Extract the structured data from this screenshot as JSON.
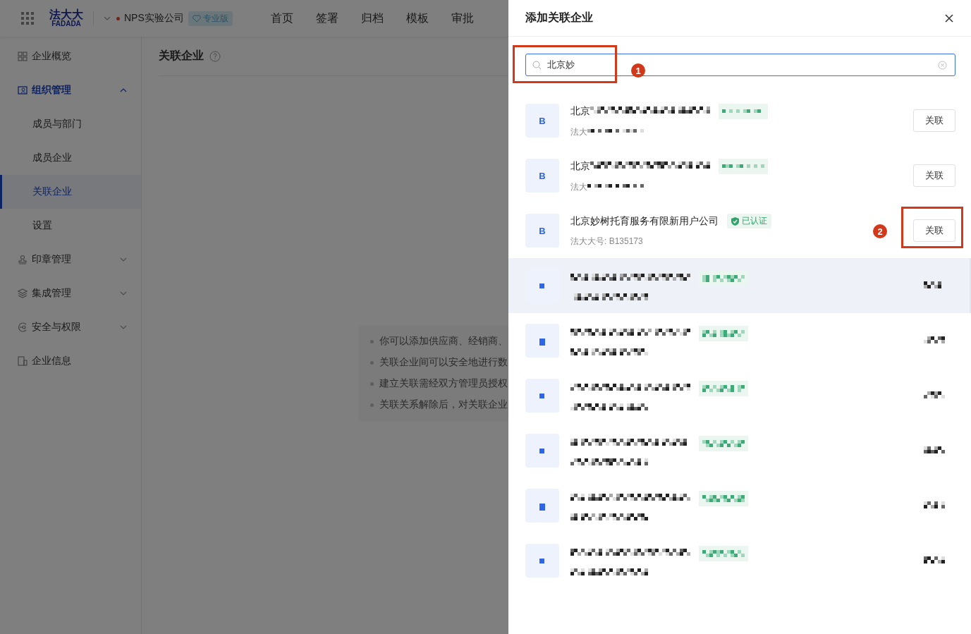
{
  "topbar": {
    "logo_cn": "法大大",
    "logo_en": "FADADA",
    "company": "NPS实验公司",
    "edition": "专业版",
    "nav": [
      "首页",
      "签署",
      "归档",
      "模板",
      "审批"
    ]
  },
  "sidebar": {
    "items": [
      {
        "label": "企业概览"
      },
      {
        "label": "组织管理",
        "expanded": true,
        "children": [
          {
            "label": "成员与部门",
            "selected": false
          },
          {
            "label": "成员企业",
            "selected": false
          },
          {
            "label": "关联企业",
            "selected": true
          },
          {
            "label": "设置",
            "selected": false
          }
        ]
      },
      {
        "label": "印章管理",
        "expanded": false
      },
      {
        "label": "集成管理",
        "expanded": false
      },
      {
        "label": "安全与权限",
        "expanded": false
      },
      {
        "label": "企业信息"
      }
    ]
  },
  "page": {
    "title": "关联企业",
    "tips": [
      "你可以添加供应商、经销商、",
      "关联企业间可以安全地进行数",
      "建立关联需经双方管理员授权",
      "关联关系解除后，对关联企业"
    ]
  },
  "drawer": {
    "title": "添加关联企业",
    "search": {
      "value": "北京妙"
    },
    "results": [
      {
        "kind": "partial",
        "avatar": "B",
        "name": "北京",
        "sub": "法大",
        "button": "关联",
        "hovered": false
      },
      {
        "kind": "partial",
        "avatar": "B",
        "name": "北京",
        "sub": "法大",
        "button": "关联",
        "hovered": false
      },
      {
        "kind": "company",
        "avatar": "B",
        "name": "北京妙树托育服务有限新用户公司",
        "badge": "已认证",
        "sub": "法大大号: B135173",
        "button": "关联",
        "hovered": false
      },
      {
        "kind": "masked",
        "hovered": true
      },
      {
        "kind": "masked",
        "hovered": false
      },
      {
        "kind": "masked",
        "hovered": false
      },
      {
        "kind": "masked",
        "hovered": false
      },
      {
        "kind": "masked",
        "hovered": false
      },
      {
        "kind": "masked",
        "hovered": false
      }
    ]
  },
  "annotations": [
    {
      "number": "1"
    },
    {
      "number": "2"
    }
  ]
}
